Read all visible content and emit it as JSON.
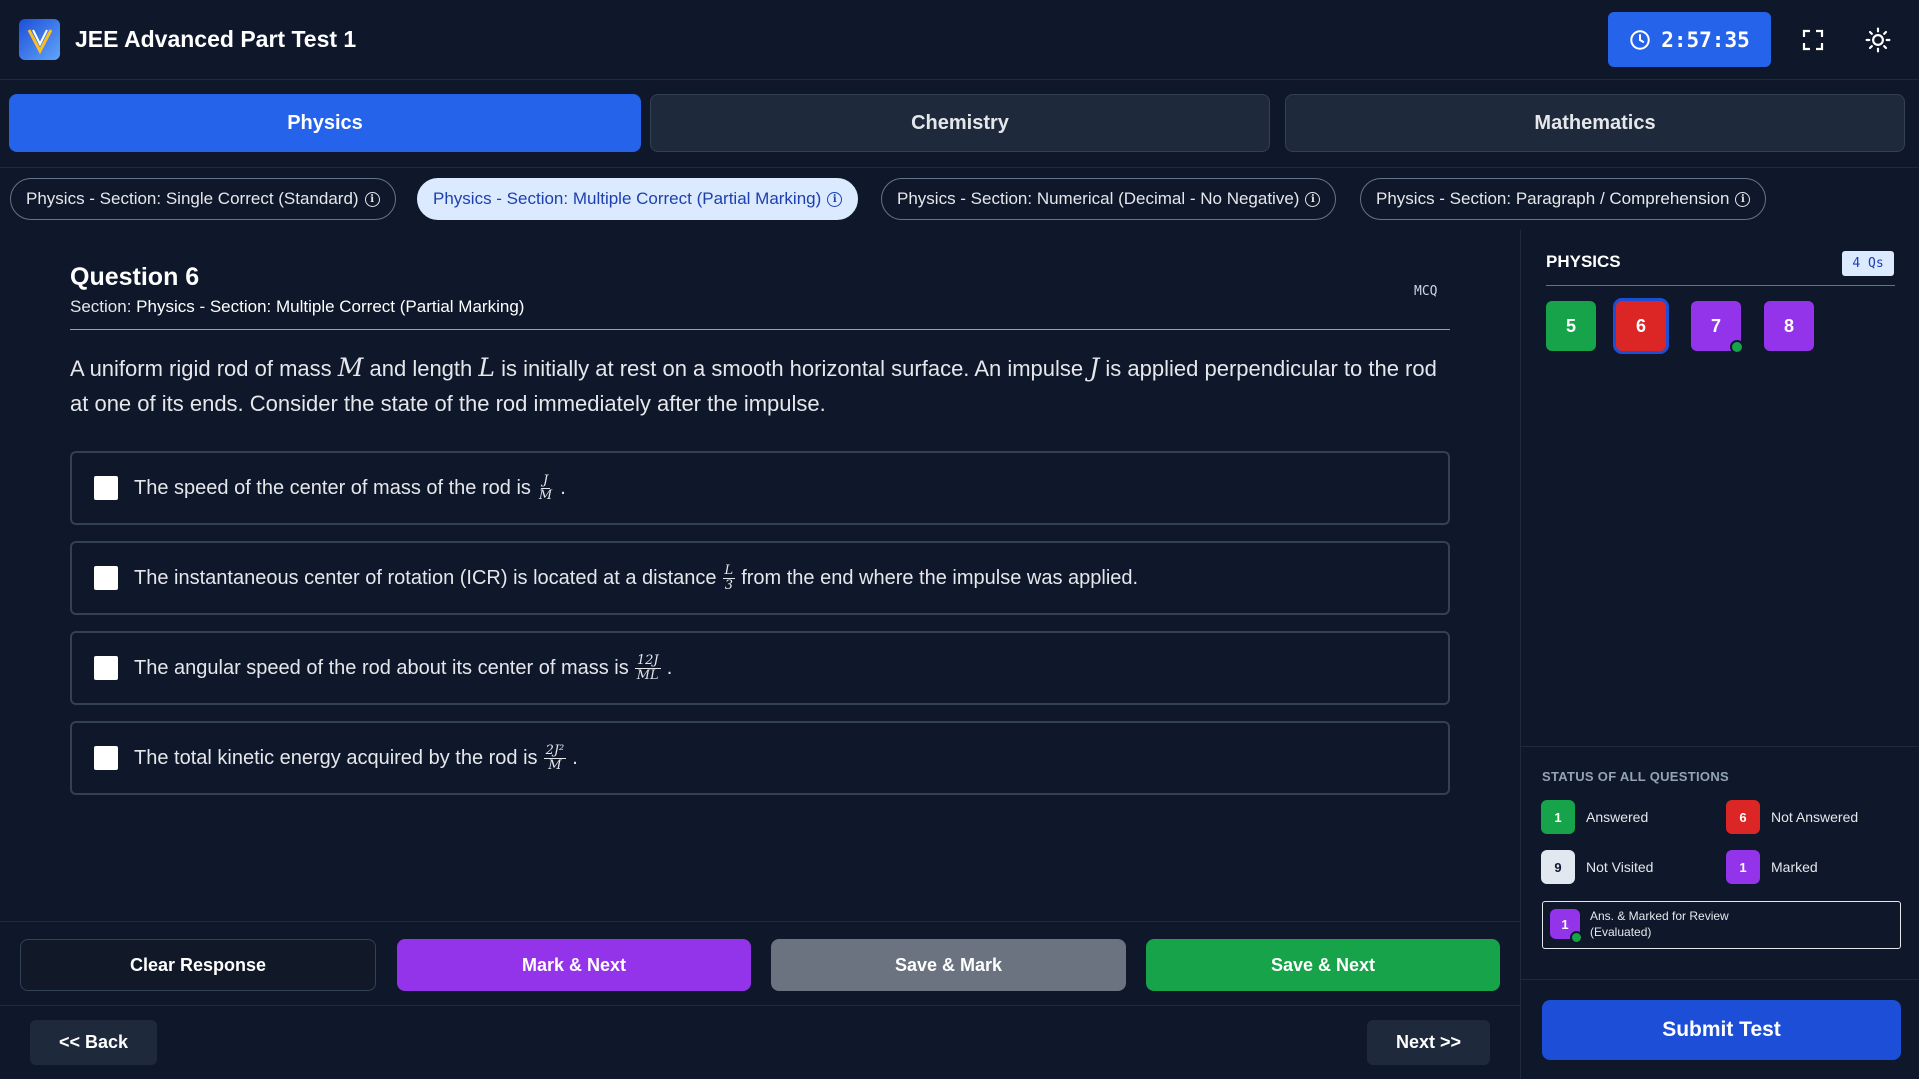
{
  "header": {
    "title": "JEE Advanced Part Test 1",
    "timer": "2:57:35",
    "icons": [
      "clock-icon",
      "fullscreen-icon",
      "theme-toggle-icon"
    ]
  },
  "subjects": [
    {
      "label": "Physics",
      "active": true
    },
    {
      "label": "Chemistry",
      "active": false
    },
    {
      "label": "Mathematics",
      "active": false
    }
  ],
  "sections": [
    {
      "label": "Physics - Section: Single Correct (Standard)",
      "active": false
    },
    {
      "label": "Physics - Section: Multiple Correct (Partial Marking)",
      "active": true
    },
    {
      "label": "Physics - Section: Numerical (Decimal - No Negative)",
      "active": false
    },
    {
      "label": "Physics - Section: Paragraph / Comprehension",
      "active": false
    }
  ],
  "question": {
    "title": "Question 6",
    "section_prefix": "Section: ",
    "section_name": "Physics - Section: Multiple Correct (Partial Marking)",
    "type": "MCQ",
    "text_parts": [
      "A uniform rigid rod of mass ",
      "M",
      " and length ",
      "L",
      " is initially at rest on a smooth horizontal surface. An impulse ",
      "J",
      " is applied perpendicular to the rod at one of its ends. Consider the state of the rod immediately after the impulse."
    ],
    "options": [
      {
        "before": "The speed of the center of mass of the rod is",
        "num": "J",
        "den": "M",
        "after": "."
      },
      {
        "before": "The instantaneous center of rotation (ICR) is located at a distance",
        "num": "L",
        "den": "3",
        "after": "from the end where the impulse was applied."
      },
      {
        "before": "The angular speed of the rod about its center of mass is",
        "num": "12J",
        "den": "ML",
        "after": "."
      },
      {
        "before": "The total kinetic energy acquired by the rod is",
        "num": "2J²",
        "den": "M",
        "after": "."
      }
    ]
  },
  "actions": {
    "clear": "Clear Response",
    "mark_next": "Mark & Next",
    "save_mark": "Save & Mark",
    "save_next": "Save & Next",
    "back": "<< Back",
    "next": "Next >>"
  },
  "panel": {
    "title": "PHYSICS",
    "count": "4 Qs",
    "questions": [
      {
        "num": "5",
        "status": "answered"
      },
      {
        "num": "6",
        "status": "not-answered"
      },
      {
        "num": "7",
        "status": "marked-answered"
      },
      {
        "num": "8",
        "status": "marked"
      }
    ],
    "status_title": "STATUS OF ALL QUESTIONS",
    "legend": {
      "answered": {
        "count": "1",
        "label": "Answered"
      },
      "not_answered": {
        "count": "6",
        "label": "Not Answered"
      },
      "not_visited": {
        "count": "9",
        "label": "Not Visited"
      },
      "marked": {
        "count": "1",
        "label": "Marked"
      },
      "ans_marked": {
        "count": "1",
        "label_line1": "Ans. & Marked for Review",
        "label_line2": "(Evaluated)"
      }
    },
    "submit": "Submit Test"
  },
  "colors": {
    "background": "#0f172a",
    "primary": "#2563eb",
    "answered": "#16a34a",
    "not_answered": "#dc2626",
    "marked": "#9333ea",
    "not_visited": "#e2e8f0"
  }
}
